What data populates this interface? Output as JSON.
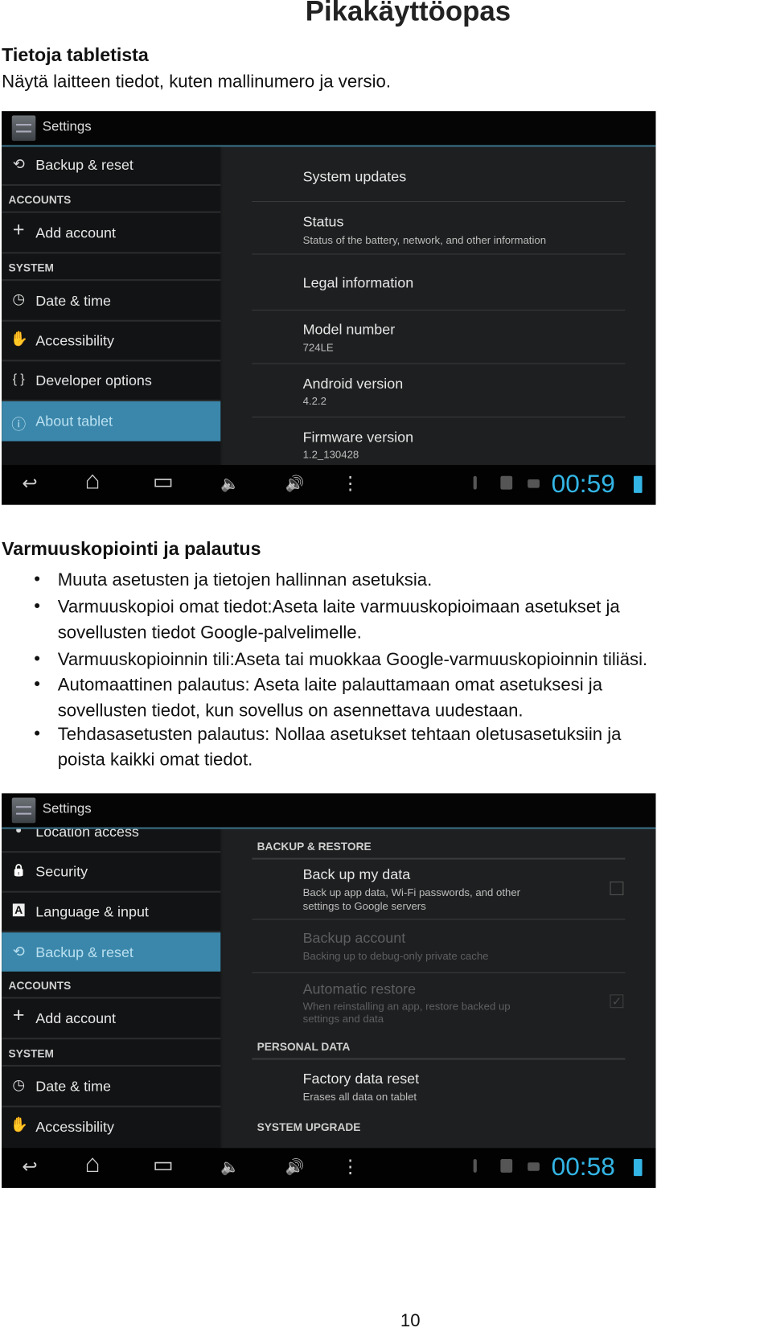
{
  "doc": {
    "title": "Pikakäyttöopas",
    "section1": {
      "heading": "Tietoja tabletista",
      "text": "Näytä laitteen tiedot, kuten mallinumero ja versio."
    },
    "section2": {
      "heading": "Varmuuskopiointi ja palautus",
      "bullets": [
        [
          "Muuta asetusten ja tietojen hallinnan asetuksia."
        ],
        [
          "Varmuuskopioi omat tiedot:Aseta laite varmuuskopioimaan asetukset ja",
          "sovellusten tiedot Google-palvelimelle."
        ],
        [
          "Varmuuskopioinnin tili:Aseta tai muokkaa Google-varmuuskopioinnin tiliäsi."
        ],
        [
          "Automaattinen palautus: Aseta laite palauttamaan omat asetuksesi ja",
          "sovellusten tiedot, kun sovellus on asennettava uudestaan."
        ],
        [
          "Tehdasasetusten palautus: Nollaa asetukset tehtaan oletusasetuksiin ja",
          "poista kaikki omat tiedot."
        ]
      ],
      "bullet_symbol": "•"
    },
    "page_number": "10"
  },
  "shot1": {
    "app_title": "Settings",
    "left": {
      "backup": "Backup & reset",
      "accounts": "ACCOUNTS",
      "add_account": "Add account",
      "system": "SYSTEM",
      "date_time": "Date & time",
      "accessibility": "Accessibility",
      "developer": "Developer options",
      "about": "About tablet"
    },
    "right": {
      "system_updates": "System updates",
      "status": "Status",
      "status_sub": "Status of the battery, network, and other information",
      "legal": "Legal information",
      "model": "Model number",
      "model_val": "724LE",
      "android": "Android version",
      "android_val": "4.2.2",
      "firmware": "Firmware version",
      "firmware_val": "1.2_130428"
    },
    "time": "00:59",
    "selected": "About tablet"
  },
  "shot2": {
    "app_title": "Settings",
    "left": {
      "location": "Location access",
      "security": "Security",
      "language": "Language & input",
      "backup": "Backup & reset",
      "accounts": "ACCOUNTS",
      "add_account": "Add account",
      "system": "SYSTEM",
      "date_time": "Date & time",
      "accessibility": "Accessibility"
    },
    "right": {
      "h_backup": "BACKUP & RESTORE",
      "backup_data": "Back up my data",
      "backup_data_sub1": "Back up app data, Wi-Fi passwords, and other",
      "backup_data_sub2": "settings to Google servers",
      "backup_account": "Backup account",
      "backup_account_sub": "Backing up to debug-only private cache",
      "auto_restore": "Automatic restore",
      "auto_restore_sub1": "When reinstalling an app, restore backed up",
      "auto_restore_sub2": "settings and data",
      "h_personal": "PERSONAL DATA",
      "factory": "Factory data reset",
      "factory_sub": "Erases all data on tablet",
      "h_upgrade": "SYSTEM UPGRADE"
    },
    "backup_data_checked": false,
    "auto_restore_checked": true,
    "time": "00:58",
    "selected": "Backup & reset"
  },
  "icons": {
    "back": "↩",
    "home": "⌂",
    "recents": "▭",
    "vol_down": "🔈",
    "vol_up": "🔊",
    "menu": "⋮",
    "check": "✓",
    "plus": "+",
    "restore": "⟲",
    "clock": "◷",
    "hand": "✋",
    "braces": "{ }",
    "info": "ⓘ",
    "lock": "🔒",
    "lang": "A",
    "location": "●"
  },
  "colors": {
    "accent": "#33b5e5",
    "selected": "#3b87ab"
  }
}
